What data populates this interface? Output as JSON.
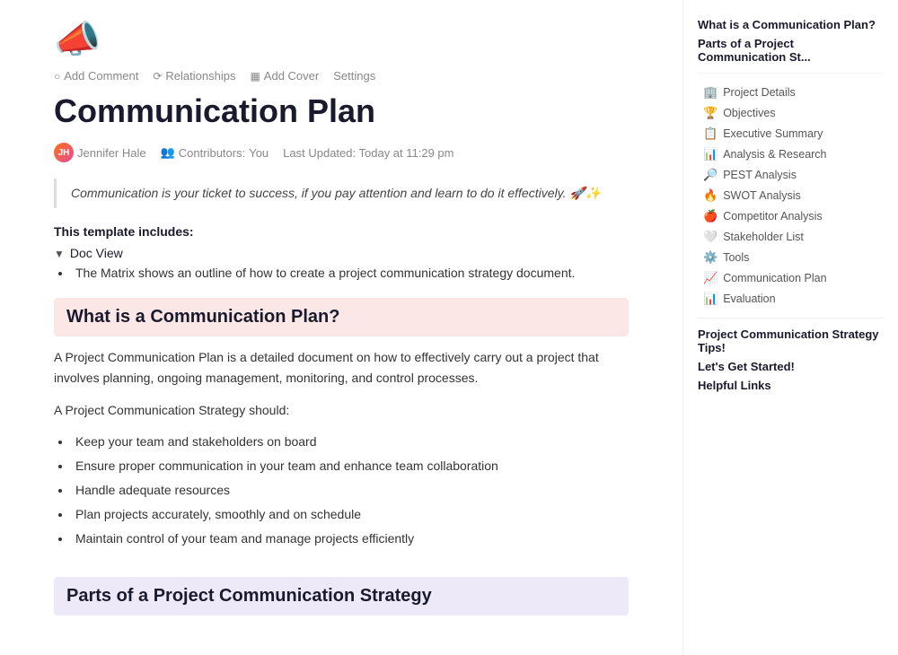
{
  "icon": "📣",
  "toolbar": {
    "add_comment_label": "Add Comment",
    "relationships_label": "Relationships",
    "add_cover_label": "Add Cover",
    "settings_label": "Settings",
    "comment_icon": "💬",
    "relationships_icon": "🔗",
    "cover_icon": "🖼"
  },
  "page": {
    "title": "Communication Plan",
    "author": "Jennifer Hale",
    "author_initials": "JH",
    "contributors_label": "Contributors:",
    "contributors_value": "You",
    "last_updated_label": "Last Updated:",
    "last_updated_value": "Today at 11:29 pm"
  },
  "quote": {
    "text": "Communication is your ticket to success, if you pay attention and learn to do it effectively. 🚀✨"
  },
  "template_section": {
    "title": "This template includes:",
    "doc_view_label": "Doc View",
    "matrix_text": "The Matrix shows an outline of how to create a project communication strategy document."
  },
  "what_section": {
    "heading": "What is a Communication Plan?",
    "paragraph1": "A Project Communication Plan is a detailed document on how to effectively carry out a project that involves planning, ongoing management, monitoring, and control processes.",
    "paragraph2": "A Project Communication Strategy should:",
    "bullet_points": [
      "Keep your team and stakeholders on board",
      "Ensure proper communication in your team and enhance team collaboration",
      "Handle adequate resources",
      "Plan projects accurately, smoothly and on schedule",
      "Maintain control of your team and manage projects efficiently"
    ]
  },
  "parts_section": {
    "heading": "Parts of a Project Communication Strategy"
  },
  "sidebar": {
    "top_items": [
      "What is a Communication Plan?",
      "Parts of a Project Communication St..."
    ],
    "items": [
      {
        "icon": "🏢",
        "label": "Project Details"
      },
      {
        "icon": "🏆",
        "label": "Objectives"
      },
      {
        "icon": "📋",
        "label": "Executive Summary"
      },
      {
        "icon": "📊",
        "label": "Analysis & Research"
      },
      {
        "icon": "🔎",
        "label": "PEST Analysis"
      },
      {
        "icon": "🔥",
        "label": "SWOT Analysis"
      },
      {
        "icon": "🍎",
        "label": "Competitor Analysis"
      },
      {
        "icon": "🤍",
        "label": "Stakeholder List"
      },
      {
        "icon": "⚙️",
        "label": "Tools"
      },
      {
        "icon": "📈",
        "label": "Communication Plan"
      },
      {
        "icon": "📊",
        "label": "Evaluation"
      }
    ],
    "bottom_items": [
      "Project Communication Strategy Tips!",
      "Let's Get Started!",
      "Helpful Links"
    ]
  }
}
